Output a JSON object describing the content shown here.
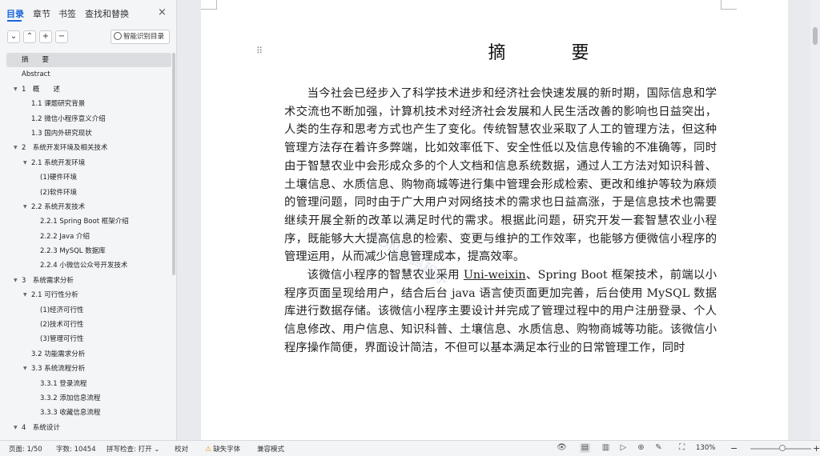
{
  "nav": {
    "tabs": [
      "目录",
      "章节",
      "书签",
      "查找和替换"
    ],
    "close_icon": "×",
    "tools": {
      "collapse": "⌄",
      "expand": "⌃",
      "add": "+",
      "remove": "−"
    },
    "smart_toc_label": "智能识别目录",
    "toc": [
      {
        "label": "摘　　要",
        "level": 1,
        "arrow": "",
        "selected": true
      },
      {
        "label": "Abstract",
        "level": 1,
        "arrow": ""
      },
      {
        "label": "1　概　　述",
        "level": 1,
        "arrow": "▼"
      },
      {
        "label": "1.1 课题研究背景",
        "level": 2,
        "arrow": ""
      },
      {
        "label": "1.2 微信小程序意义介绍",
        "level": 2,
        "arrow": ""
      },
      {
        "label": "1.3 国内外研究现状",
        "level": 2,
        "arrow": ""
      },
      {
        "label": "2　系统开发环境及相关技术",
        "level": 1,
        "arrow": "▼"
      },
      {
        "label": "2.1 系统开发环境",
        "level": 2,
        "arrow": "▼"
      },
      {
        "label": "(1)硬件环境",
        "level": 3,
        "arrow": ""
      },
      {
        "label": "(2)软件环境",
        "level": 3,
        "arrow": ""
      },
      {
        "label": "2.2 系统开发技术",
        "level": 2,
        "arrow": "▼"
      },
      {
        "label": "2.2.1 Spring Boot 框架介绍",
        "level": 3,
        "arrow": ""
      },
      {
        "label": "2.2.2 Java 介绍",
        "level": 3,
        "arrow": ""
      },
      {
        "label": "2.2.3 MySQL 数据库",
        "level": 3,
        "arrow": ""
      },
      {
        "label": "2.2.4 小微信公众号开发技术",
        "level": 3,
        "arrow": ""
      },
      {
        "label": "3　系统需求分析",
        "level": 1,
        "arrow": "▼"
      },
      {
        "label": "2.1 可行性分析",
        "level": 2,
        "arrow": "▼"
      },
      {
        "label": "(1)经济可行性",
        "level": 3,
        "arrow": ""
      },
      {
        "label": "(2)技术可行性",
        "level": 3,
        "arrow": ""
      },
      {
        "label": "(3)管理可行性",
        "level": 3,
        "arrow": ""
      },
      {
        "label": "3.2 功能需求分析",
        "level": 2,
        "arrow": ""
      },
      {
        "label": "3.3 系统流程分析",
        "level": 2,
        "arrow": "▼"
      },
      {
        "label": "3.3.1 登录流程",
        "level": 3,
        "arrow": ""
      },
      {
        "label": "3.3.2 添加信息流程",
        "level": 3,
        "arrow": ""
      },
      {
        "label": "3.3.3 收藏信息流程",
        "level": 3,
        "arrow": ""
      },
      {
        "label": "4　系统设计",
        "level": 1,
        "arrow": "▼"
      }
    ]
  },
  "document": {
    "title": "摘　要",
    "drag_handle": "⠿",
    "watermark": "CSDN源码程序",
    "paragraph1": "当今社会已经步入了科学技术进步和经济社会快速发展的新时期，国际信息和学术交流也不断加强，计算机技术对经济社会发展和人民生活改善的影响也日益突出，人类的生存和思考方式也产生了变化。传统智慧农业采取了人工的管理方法，但这种管理方法存在着许多弊端，比如效率低下、安全性低以及信息传输的不准确等，同时由于智慧农业中会形成众多的个人文档和信息系统数据，通过人工方法对知识科普、土壤信息、水质信息、购物商城等进行集中管理会形成检索、更改和维护等较为麻烦的管理问题，同时由于广大用户对网络技术的需求也日益高涨，于是信息技术也需要继续开展全新的改革以满足时代的需求。根据此问题，研究开发一套智慧农业小程序，既能够大大提高信息的检索、变更与维护的工作效率，也能够方便微信小程序的管理运用，从而减少信息管理成本，提高效率。",
    "p2_a": "该微信小程序的智慧农业采用 ",
    "p2_uni": "Uni-weixin",
    "p2_b": "、Spring Boot 框架技术，前端以小程序页面呈现给用户，结合后台 java 语言使页面更加完善，后台使用 MySQL 数据库进行数据存储。该微信小程序主要设计并完成了管理过程中的用户注册登录、个人信息修改、用户信息、知识科普、土壤信息、水质信息、购物商城等功能。该微信小程序操作简便，界面设计简洁，不但可以基本满足本行业的日常管理工作，同时"
  },
  "status": {
    "page": "页面: 1/50",
    "words": "字数: 10454",
    "spell": "拼写检查: 打开",
    "spell_arrow": "⌄",
    "proof": "校对",
    "missing_font": "缺失字体",
    "warn_icon": "⚠",
    "compat": "兼容模式",
    "zoom": "130%",
    "zoom_minus": "−",
    "zoom_plus": "+",
    "icons": [
      "👁",
      "▤",
      "▥",
      "▷",
      "⊕",
      "✎",
      "⛶"
    ]
  },
  "colors": {
    "accent": "#1a66d9",
    "page": "#ffffff",
    "background": "#e8eaed",
    "warning": "#e69a00"
  }
}
